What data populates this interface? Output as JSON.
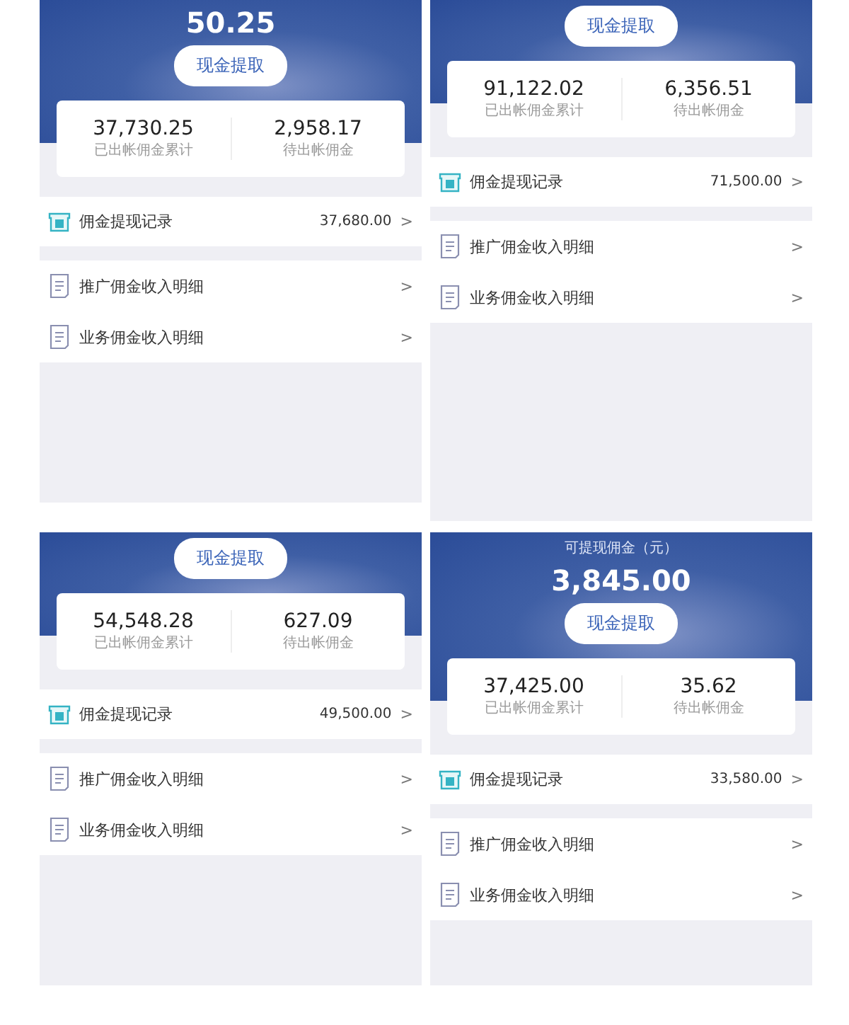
{
  "panels": [
    {
      "amount": "50.25",
      "button": "现金提取",
      "stats": [
        {
          "value": "37,730.25",
          "label": "已出帐佣金累计"
        },
        {
          "value": "2,958.17",
          "label": "待出帐佣金"
        }
      ],
      "record": {
        "label": "佣金提现记录",
        "amount": "37,680.00",
        "chevron": ">"
      },
      "rows": [
        {
          "label": "推广佣金收入明细",
          "chevron": ">"
        },
        {
          "label": "业务佣金收入明细",
          "chevron": ">"
        }
      ]
    },
    {
      "button": "现金提取",
      "stats": [
        {
          "value": "91,122.02",
          "label": "已出帐佣金累计"
        },
        {
          "value": "6,356.51",
          "label": "待出帐佣金"
        }
      ],
      "record": {
        "label": "佣金提现记录",
        "amount": "71,500.00",
        "chevron": ">"
      },
      "rows": [
        {
          "label": "推广佣金收入明细",
          "chevron": ">"
        },
        {
          "label": "业务佣金收入明细",
          "chevron": ">"
        }
      ]
    },
    {
      "button": "现金提取",
      "stats": [
        {
          "value": "54,548.28",
          "label": "已出帐佣金累计"
        },
        {
          "value": "627.09",
          "label": "待出帐佣金"
        }
      ],
      "record": {
        "label": "佣金提现记录",
        "amount": "49,500.00",
        "chevron": ">"
      },
      "rows": [
        {
          "label": "推广佣金收入明细",
          "chevron": ">"
        },
        {
          "label": "业务佣金收入明细",
          "chevron": ">"
        }
      ]
    },
    {
      "title": "可提现佣金（元）",
      "amount": "3,845.00",
      "button": "现金提取",
      "stats": [
        {
          "value": "37,425.00",
          "label": "已出帐佣金累计"
        },
        {
          "value": "35.62",
          "label": "待出帐佣金"
        }
      ],
      "record": {
        "label": "佣金提现记录",
        "amount": "33,580.00",
        "chevron": ">"
      },
      "rows": [
        {
          "label": "推广佣金收入明细",
          "chevron": ">"
        },
        {
          "label": "业务佣金收入明细",
          "chevron": ">"
        }
      ]
    }
  ]
}
